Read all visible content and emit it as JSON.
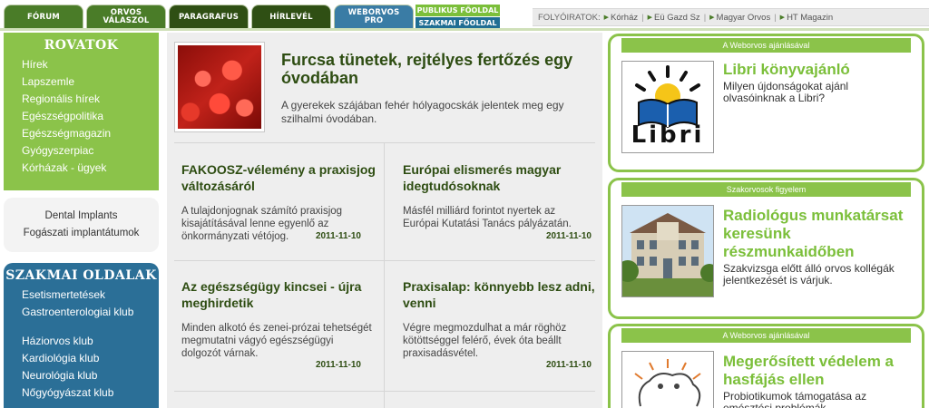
{
  "nav": {
    "tabs": [
      {
        "label": "FÓRUM"
      },
      {
        "label_line1": "ORVOS",
        "label_line2": "VÁLASZOL"
      },
      {
        "label": "PARAGRAFUS"
      },
      {
        "label": "HÍRLEVÉL"
      },
      {
        "label_line1": "WEBORVOS",
        "label_line2": "PRO"
      }
    ],
    "publikus": "PUBLIKUS FŐOLDAL",
    "szakmai": "SZAKMAI FŐOLDAL",
    "periodicals_label": "FOLYÓIRATOK:",
    "periodicals": [
      "Kórház",
      "Eü Gazd Sz",
      "Magyar Orvos",
      "HT Magazin"
    ]
  },
  "sidebar": {
    "rovatok_title": "ROVATOK",
    "rovatok": [
      "Hírek",
      "Lapszemle",
      "Regionális hírek",
      "Egészségpolitika",
      "Egészségmagazin",
      "Gyógyszerpiac",
      "Kórházak - ügyek"
    ],
    "dental": [
      "Dental Implants",
      "Fogászati implantátumok"
    ],
    "szakmai_title": "SZAKMAI OLDALAK",
    "szakmai": [
      "Esetismertetések",
      "Gastroenterologiai klub",
      "Háziorvos klub",
      "Kardiológia klub",
      "Neurológia klub",
      "Nőgyógyászat klub"
    ]
  },
  "featured": {
    "title": "Furcsa tünetek, rejtélyes fertőzés egy óvodában",
    "text": "A gyerekek szájában fehér hólyagocskák jelentek meg egy szilhalmi óvodában."
  },
  "articles": [
    {
      "title": "FAKOOSZ-vélemény a praxisjog változásáról",
      "text": "A tulajdonjognak számító praxisjog kisajátításával lenne egyenlő az önkormányzati vétójog.",
      "date": "2011-11-10"
    },
    {
      "title": "Európai elismerés magyar idegtudósoknak",
      "text": "Másfél milliárd forintot nyertek az Európai Kutatási Tanács pályázatán.",
      "date": "2011-11-10"
    },
    {
      "title": "Az egészségügy kincsei - újra meghirdetik",
      "text": "Minden alkotó és zenei-prózai tehetségét megmutatni vágyó egészségügyi dolgozót várnak.",
      "date": "2011-11-10"
    },
    {
      "title": "Praxisalap: könnyebb lesz adni, venni",
      "text": "Végre megmozdulhat a már röghöz kötöttséggel felérő, évek óta beállt praxisadásvétel.",
      "date": "2011-11-10"
    }
  ],
  "right": [
    {
      "header": "A Weborvos ajánlásával",
      "title": "Libri könyvajánló",
      "text": "Milyen újdonságokat ajánl olvasóinknak a Libri?",
      "logo_text": "Libri"
    },
    {
      "header": "Szakorvosok figyelem",
      "title": "Radiológus munkatársat keresünk részmunkaidőben",
      "text": "Szakvizsga előtt álló orvos kollégák jelentkezését is várjuk."
    },
    {
      "header": "A Weborvos ajánlásával",
      "title": "Megerősített védelem a hasfájás ellen",
      "text": "Probiotikumok támogatása az emésztési problémák"
    }
  ],
  "colors": {
    "green": "#8bc34a",
    "dark_green": "#2e4d12",
    "blue": "#2b6f97",
    "light_green": "#7bbf3a"
  }
}
